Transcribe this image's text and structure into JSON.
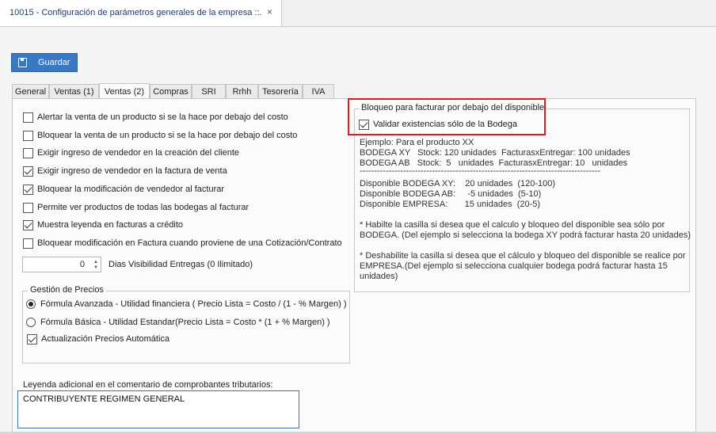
{
  "document_tab": {
    "title": "10015 - Configuración de parámetros generales de la empresa ::.",
    "close": "×"
  },
  "toolbar": {
    "save_label": "Guardar",
    "save_icon": "floppy-disk-icon"
  },
  "tabs": [
    "General",
    "Ventas (1)",
    "Ventas (2)",
    "Compras",
    "SRI",
    "Rrhh",
    "Tesorería",
    "IVA"
  ],
  "active_tab": "Ventas (2)",
  "options": [
    {
      "label": "Alertar la venta de un producto si se la hace por debajo del costo",
      "checked": false
    },
    {
      "label": "Bloquear la venta de un producto si se la hace por debajo del costo",
      "checked": false
    },
    {
      "label": "Exigir ingreso de vendedor en la creación del cliente",
      "checked": false
    },
    {
      "label": "Exigir ingreso de vendedor en la factura de venta",
      "checked": true
    },
    {
      "label": "Bloquear la modificación de vendedor al facturar",
      "checked": true
    },
    {
      "label": "Permite ver productos de todas las bodegas al facturar",
      "checked": false
    },
    {
      "label": "Muestra leyenda en facturas a crédito",
      "checked": true
    },
    {
      "label": "Bloquear modificación en Factura cuando proviene de una Cotización/Contrato",
      "checked": false
    }
  ],
  "dias_visibilidad": {
    "value": "0",
    "label": "Dias Visibilidad Entregas (0 Ilimitado)"
  },
  "precios": {
    "title": "Gestión de Precios",
    "radios": [
      {
        "label": "Fórmula Avanzada - Utilidad financiera ( Precio Lista = Costo / (1 - % Margen) )",
        "checked": true
      },
      {
        "label": "Fórmula Básica - Utilidad Estandar(Precio Lista = Costo * (1 + % Margen) )",
        "checked": false
      }
    ],
    "auto_update": {
      "label": "Actualización Precios Automática",
      "checked": true
    }
  },
  "leyenda": {
    "label": "Leyenda adicional en el comentario de comprobantes tributarios:",
    "value": "CONTRIBUYENTE REGIMEN GENERAL"
  },
  "bloqueo": {
    "title": "Bloqueo para facturar por debajo del disponible",
    "checkbox": {
      "label": "Validar existencias sólo de la Bodega",
      "checked": true
    },
    "example_lines": [
      "Ejemplo: Para el producto XX",
      "BODEGA XY   Stock: 120 unidades  FacturasxEntregar: 100 unidades",
      "BODEGA AB   Stock:  5   unidades  FacturasxEntregar: 10   unidades",
      "-----------------------------------------------------------------------------------",
      "Disponible BODEGA XY:    20 unidades  (120-100)",
      "Disponible BODEGA AB:     -5 unidades  (5-10)",
      "Disponible EMPRESA:       15 unidades  (20-5)"
    ],
    "note1": [
      "* Habilte la casilla si desea que el calculo y bloqueo del disponible sea sólo por",
      "BODEGA. (Del ejemplo si selecciona la bodega XY podrá facturar hasta 20 unidades)"
    ],
    "note2": [
      "* Deshabilite la casilla si desea que el cálculo y bloqueo del disponible se realice por",
      "EMPRESA.(Del ejemplo si selecciona cualquier bodega podrá facturar hasta 15",
      "unidades)"
    ]
  },
  "colors": {
    "accent": "#3a78c4",
    "highlight": "#e0191f",
    "tab_text": "#1f3b73"
  }
}
